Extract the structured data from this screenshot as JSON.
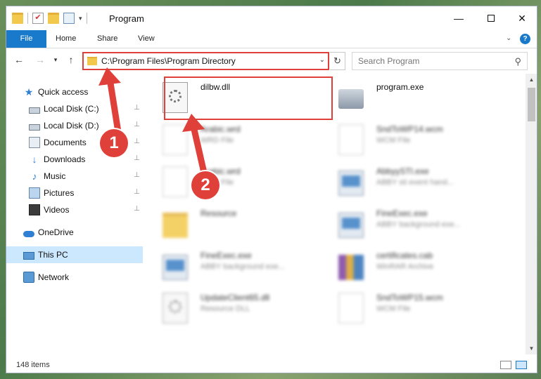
{
  "window": {
    "title": "Program",
    "minimize_glyph": "—",
    "close_glyph": "✕"
  },
  "quick_access_toolbar": {
    "dropdown_glyph": "▾"
  },
  "ribbon": {
    "tabs": [
      {
        "label": "File"
      },
      {
        "label": "Home"
      },
      {
        "label": "Share"
      },
      {
        "label": "View"
      }
    ],
    "expand_glyph": "⌄",
    "help_glyph": "?"
  },
  "navigation": {
    "back_glyph": "←",
    "forward_glyph": "→",
    "recent_glyph": "▾",
    "up_glyph": "↑",
    "address": "C:\\Program Files\\Program Directory",
    "address_dropdown_glyph": "⌄",
    "refresh_glyph": "↻",
    "search_placeholder": "Search Program",
    "search_glyph": "⚲"
  },
  "sidebar": {
    "items": [
      {
        "label": "Quick access",
        "icon": "star-icon",
        "pinned": false
      },
      {
        "label": "Local Disk (C:)",
        "icon": "drive-icon",
        "pinned": true
      },
      {
        "label": "Local Disk (D:)",
        "icon": "drive-icon",
        "pinned": true
      },
      {
        "label": "Documents",
        "icon": "documents-icon",
        "pinned": true
      },
      {
        "label": "Downloads",
        "icon": "download-icon",
        "pinned": true
      },
      {
        "label": "Music",
        "icon": "music-icon",
        "pinned": true
      },
      {
        "label": "Pictures",
        "icon": "pictures-icon",
        "pinned": true
      },
      {
        "label": "Videos",
        "icon": "videos-icon",
        "pinned": true
      },
      {
        "label": "OneDrive",
        "icon": "onedrive-icon",
        "pinned": false
      },
      {
        "label": "This PC",
        "icon": "pc-icon",
        "pinned": false,
        "selected": true
      },
      {
        "label": "Network",
        "icon": "network-icon",
        "pinned": false
      }
    ],
    "pin_glyph": "📌"
  },
  "files": [
    {
      "name": "dilbw.dll",
      "type": "",
      "kind": "dll",
      "highlighted": true
    },
    {
      "name": "program.exe",
      "type": "",
      "kind": "prog"
    },
    {
      "name": "Arabic.wrd",
      "type": "WRD File",
      "kind": "doc"
    },
    {
      "name": "SndToWP14.wcm",
      "type": "WCM File",
      "kind": "doc"
    },
    {
      "name": "Arabic.wrd",
      "type": "WRD File",
      "kind": "doc"
    },
    {
      "name": "AbbyySTI.exe",
      "type": "ABBY sti event hand...",
      "kind": "exe"
    },
    {
      "name": "Resource",
      "type": "",
      "kind": "folder"
    },
    {
      "name": "FineExec.exe",
      "type": "ABBY background exe...",
      "kind": "exe"
    },
    {
      "name": "FineExec.exe",
      "type": "ABBY background exe...",
      "kind": "exe"
    },
    {
      "name": "certificates.cab",
      "type": "WinRAR Archive",
      "kind": "rar"
    },
    {
      "name": "UpdateClient65.dll",
      "type": "Resource DLL",
      "kind": "dll"
    },
    {
      "name": "SndToWP15.wcm",
      "type": "WCM File",
      "kind": "doc"
    }
  ],
  "status": {
    "item_count": "148 items"
  },
  "annotations": {
    "callout_1": "1",
    "callout_2": "2",
    "highlight_color": "#e0403a"
  },
  "colors": {
    "accent": "#1979ca",
    "selection": "#cce8ff",
    "annotation_red": "#e0403a"
  }
}
